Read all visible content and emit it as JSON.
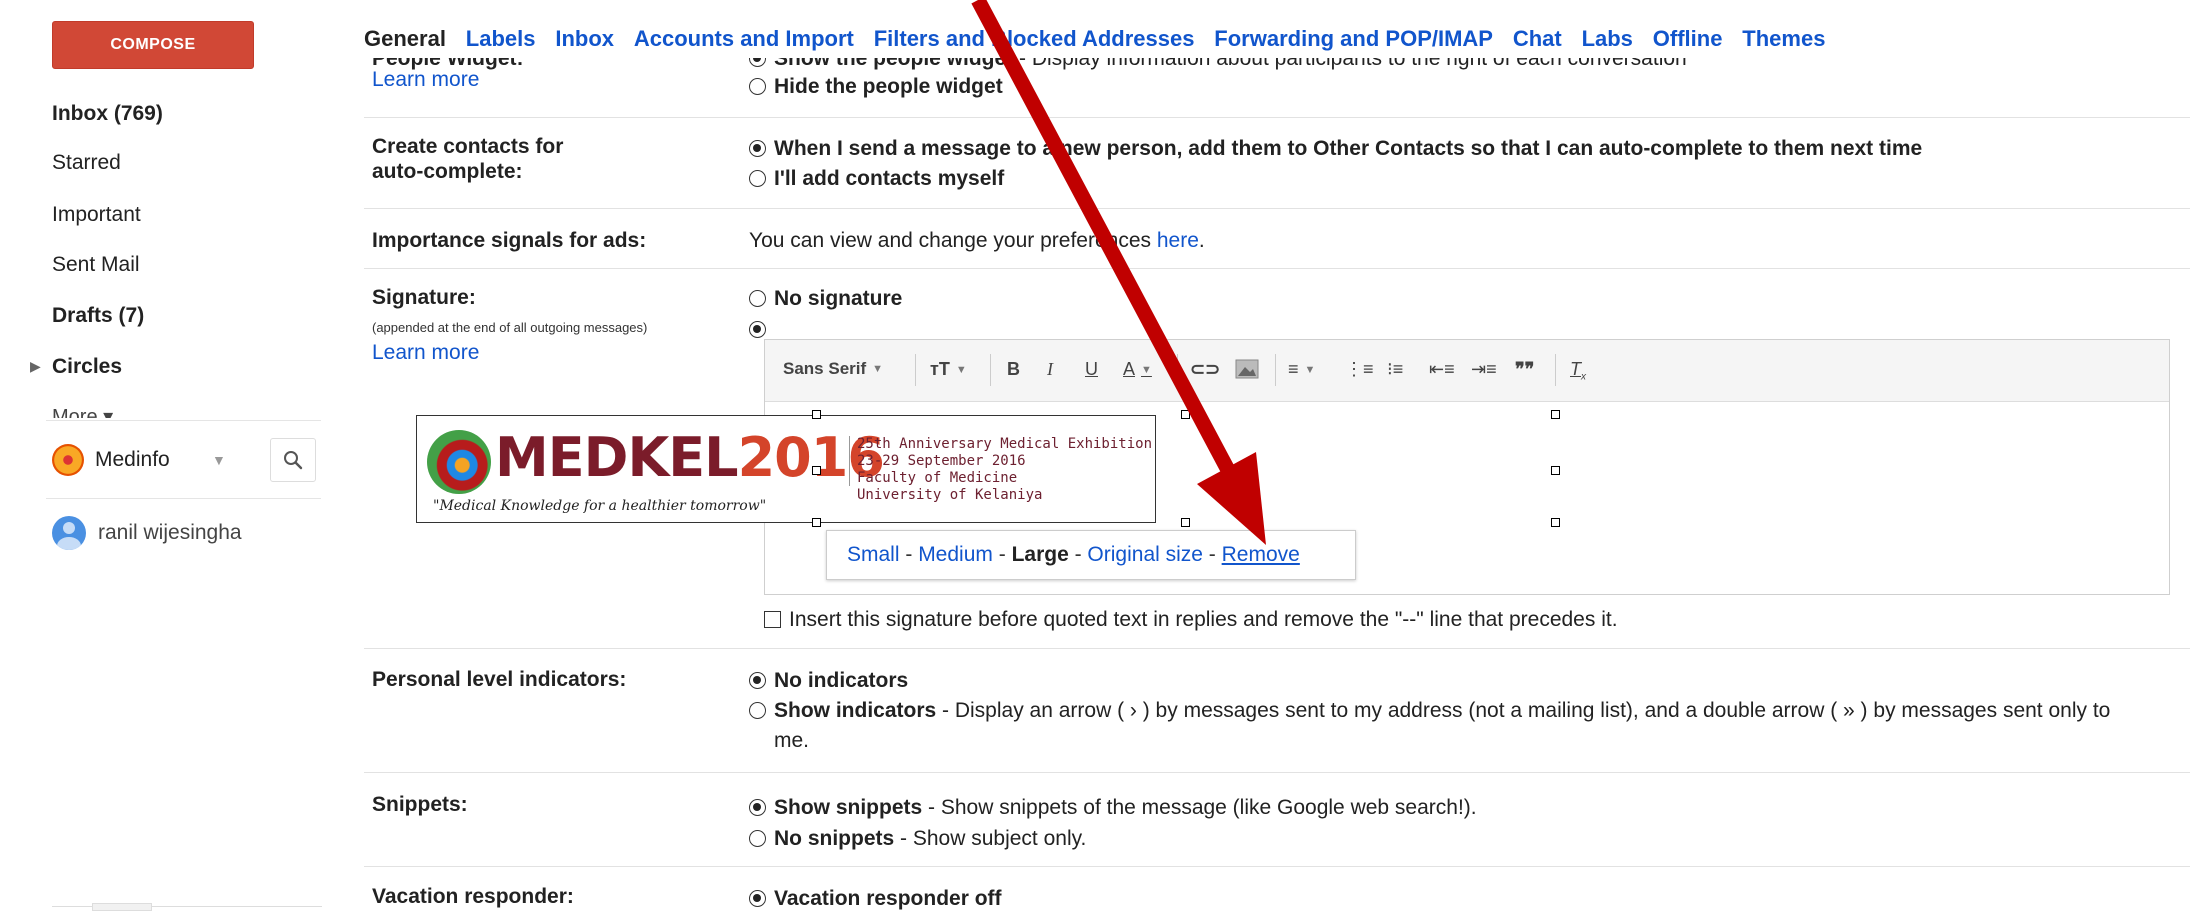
{
  "sidebar": {
    "compose_label": "COMPOSE",
    "items": [
      {
        "label": "Inbox (769)",
        "bold": true
      },
      {
        "label": "Starred",
        "bold": false
      },
      {
        "label": "Important",
        "bold": false
      },
      {
        "label": "Sent Mail",
        "bold": false
      },
      {
        "label": "Drafts (7)",
        "bold": true
      },
      {
        "label": "Circles",
        "bold": true
      },
      {
        "label": "More ▾",
        "bold": false
      }
    ],
    "account_name": "Medinfo",
    "contact_name": "ranil wijesingha"
  },
  "tabs": [
    "General",
    "Labels",
    "Inbox",
    "Accounts and Import",
    "Filters and Blocked Addresses",
    "Forwarding and POP/IMAP",
    "Chat",
    "Labs",
    "Offline",
    "Themes"
  ],
  "settings": {
    "people_widget": {
      "label": "People Widget:",
      "learn_more": "Learn more",
      "show_option": "Show the people widget",
      "show_desc": " - Display information about participants to the right of each conversation",
      "hide_option": "Hide the people widget"
    },
    "create_contacts": {
      "label_line1": "Create contacts for",
      "label_line2": "auto-complete:",
      "option1": "When I send a message to a new person, add them to Other Contacts so that I can auto-complete to them next time",
      "option2": "I'll add contacts myself"
    },
    "importance_signals": {
      "label": "Importance signals for ads:",
      "text": "You can view and change your preferences ",
      "link": "here",
      "suffix": "."
    },
    "signature": {
      "label": "Signature:",
      "note": "(appended at the end of all outgoing messages)",
      "learn_more": "Learn more",
      "no_signature": "No signature",
      "font_name": "Sans Serif",
      "image_brand_a": "MEDKEL",
      "image_brand_b": "2016",
      "image_tagline": "\"Medical Knowledge for a healthier tomorrow\"",
      "image_lines": [
        "25th Anniversary Medical Exhibition",
        "23-29 September 2016",
        "Faculty of Medicine",
        "University of Kelaniya"
      ],
      "size_small": "Small",
      "size_medium": "Medium",
      "size_large": "Large",
      "size_original": "Original size",
      "remove": "Remove",
      "insert_before_quoted": "Insert this signature before quoted text in replies and remove the \"--\" line that precedes it."
    },
    "personal_level": {
      "label": "Personal level indicators:",
      "no_indicators": "No indicators",
      "show_indicators": "Show indicators",
      "show_desc": " - Display an arrow ( › ) by messages sent to my address (not a mailing list), and a double arrow ( » ) by messages sent only to",
      "show_desc_cont": "me."
    },
    "snippets": {
      "label": "Snippets:",
      "show": "Show snippets",
      "show_desc": " - Show snippets of the message (like Google web search!).",
      "none": "No snippets",
      "none_desc": " - Show subject only."
    },
    "vacation": {
      "label": "Vacation responder:",
      "off": "Vacation responder off"
    }
  },
  "colors": {
    "compose": "#d14836",
    "link": "#1155cc",
    "arrow": "#c00000"
  }
}
